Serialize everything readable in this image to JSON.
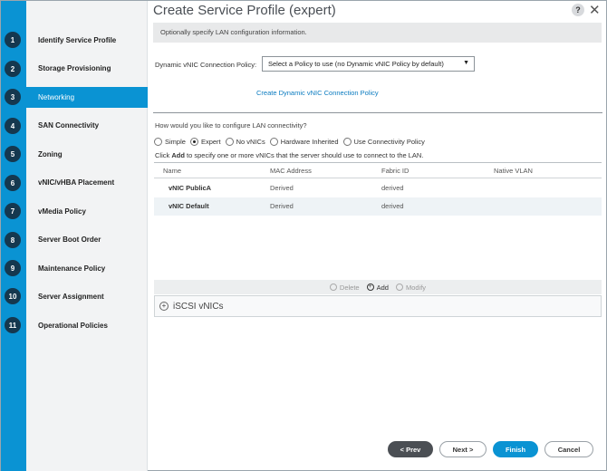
{
  "window": {
    "title": "Create Service Profile (expert)",
    "help_label": "?",
    "close_label": "✕"
  },
  "steps": [
    {
      "num": "1",
      "label": "Identify Service Profile"
    },
    {
      "num": "2",
      "label": "Storage Provisioning"
    },
    {
      "num": "3",
      "label": "Networking"
    },
    {
      "num": "4",
      "label": "SAN Connectivity"
    },
    {
      "num": "5",
      "label": "Zoning"
    },
    {
      "num": "6",
      "label": "vNIC/vHBA Placement"
    },
    {
      "num": "7",
      "label": "vMedia Policy"
    },
    {
      "num": "8",
      "label": "Server Boot Order"
    },
    {
      "num": "9",
      "label": "Maintenance Policy"
    },
    {
      "num": "10",
      "label": "Server Assignment"
    },
    {
      "num": "11",
      "label": "Operational Policies"
    }
  ],
  "active_step": "Networking",
  "info": "Optionally specify LAN configuration information.",
  "dynamic_policy": {
    "label": "Dynamic vNIC Connection Policy:",
    "value": "Select a Policy to use (no Dynamic vNIC Policy by default)",
    "arrow": "▼",
    "create_link": "Create Dynamic vNIC Connection Policy"
  },
  "lan": {
    "question": "How would you like to configure LAN connectivity?",
    "options": [
      {
        "label": "Simple",
        "checked": false
      },
      {
        "label": "Expert",
        "checked": true
      },
      {
        "label": "No vNICs",
        "checked": false
      },
      {
        "label": "Hardware Inherited",
        "checked": false
      },
      {
        "label": "Use Connectivity Policy",
        "checked": false
      }
    ],
    "instruction_prefix": "Click",
    "instruction_bold": "Add",
    "instruction_suffix": "to specify one or more vNICs that the server should use to connect to the LAN."
  },
  "table": {
    "columns": [
      "Name",
      "MAC Address",
      "Fabric ID",
      "Native VLAN"
    ],
    "rows": [
      {
        "name": "vNIC PublicA",
        "mac": "Derived",
        "fabric": "derived",
        "vlan": ""
      },
      {
        "name": "vNIC Default",
        "mac": "Derived",
        "fabric": "derived",
        "vlan": ""
      }
    ]
  },
  "actions": {
    "delete": "Delete",
    "add": "Add",
    "modify": "Modify"
  },
  "iscsi": {
    "label": "iSCSI vNICs"
  },
  "footer": {
    "prev": "< Prev",
    "next": "Next >",
    "finish": "Finish",
    "cancel": "Cancel"
  },
  "colors": {
    "accent": "#0a93d3",
    "step_badge": "#15384f",
    "prev_button": "#4b4f54"
  }
}
